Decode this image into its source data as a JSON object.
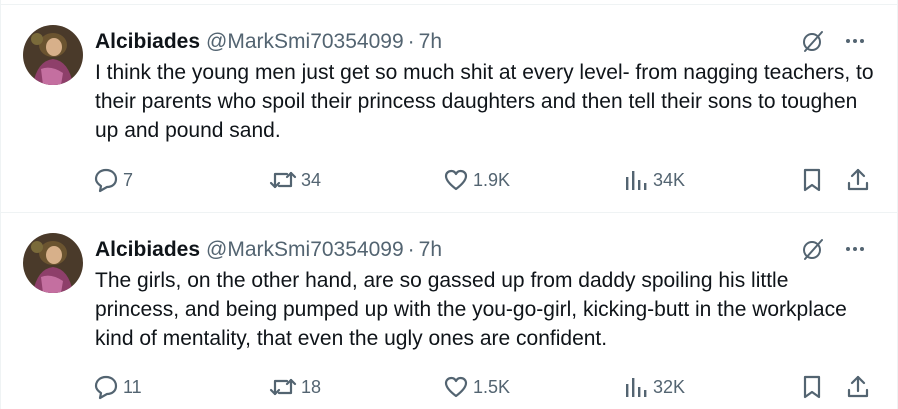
{
  "tweets": [
    {
      "author_name": "Alcibiades",
      "author_handle": "@MarkSmi70354099",
      "separator": "·",
      "time": "7h",
      "text": "I think the young men just get so much shit at every level- from nagging teachers,  to their parents who spoil their princess daughters and then tell their sons to toughen up and pound sand.",
      "replies": "7",
      "reposts": "34",
      "likes": "1.9K",
      "views": "34K"
    },
    {
      "author_name": "Alcibiades",
      "author_handle": "@MarkSmi70354099",
      "separator": "·",
      "time": "7h",
      "text": "The girls, on the other hand, are so gassed up from daddy spoiling his little princess, and being pumped up with the you-go-girl, kicking-butt in the workplace kind of mentality, that even the ugly ones are confident.",
      "replies": "11",
      "reposts": "18",
      "likes": "1.5K",
      "views": "32K"
    }
  ],
  "icons": {
    "grok": "grok-slash-circle-icon",
    "more": "more-dots-icon",
    "reply": "reply-bubble-icon",
    "repost": "repost-arrows-icon",
    "like": "heart-icon",
    "views": "views-bars-icon",
    "bookmark": "bookmark-icon",
    "share": "share-upload-icon"
  },
  "colors": {
    "text": "#0f1419",
    "secondary": "#536471",
    "divider": "#eff3f4"
  }
}
